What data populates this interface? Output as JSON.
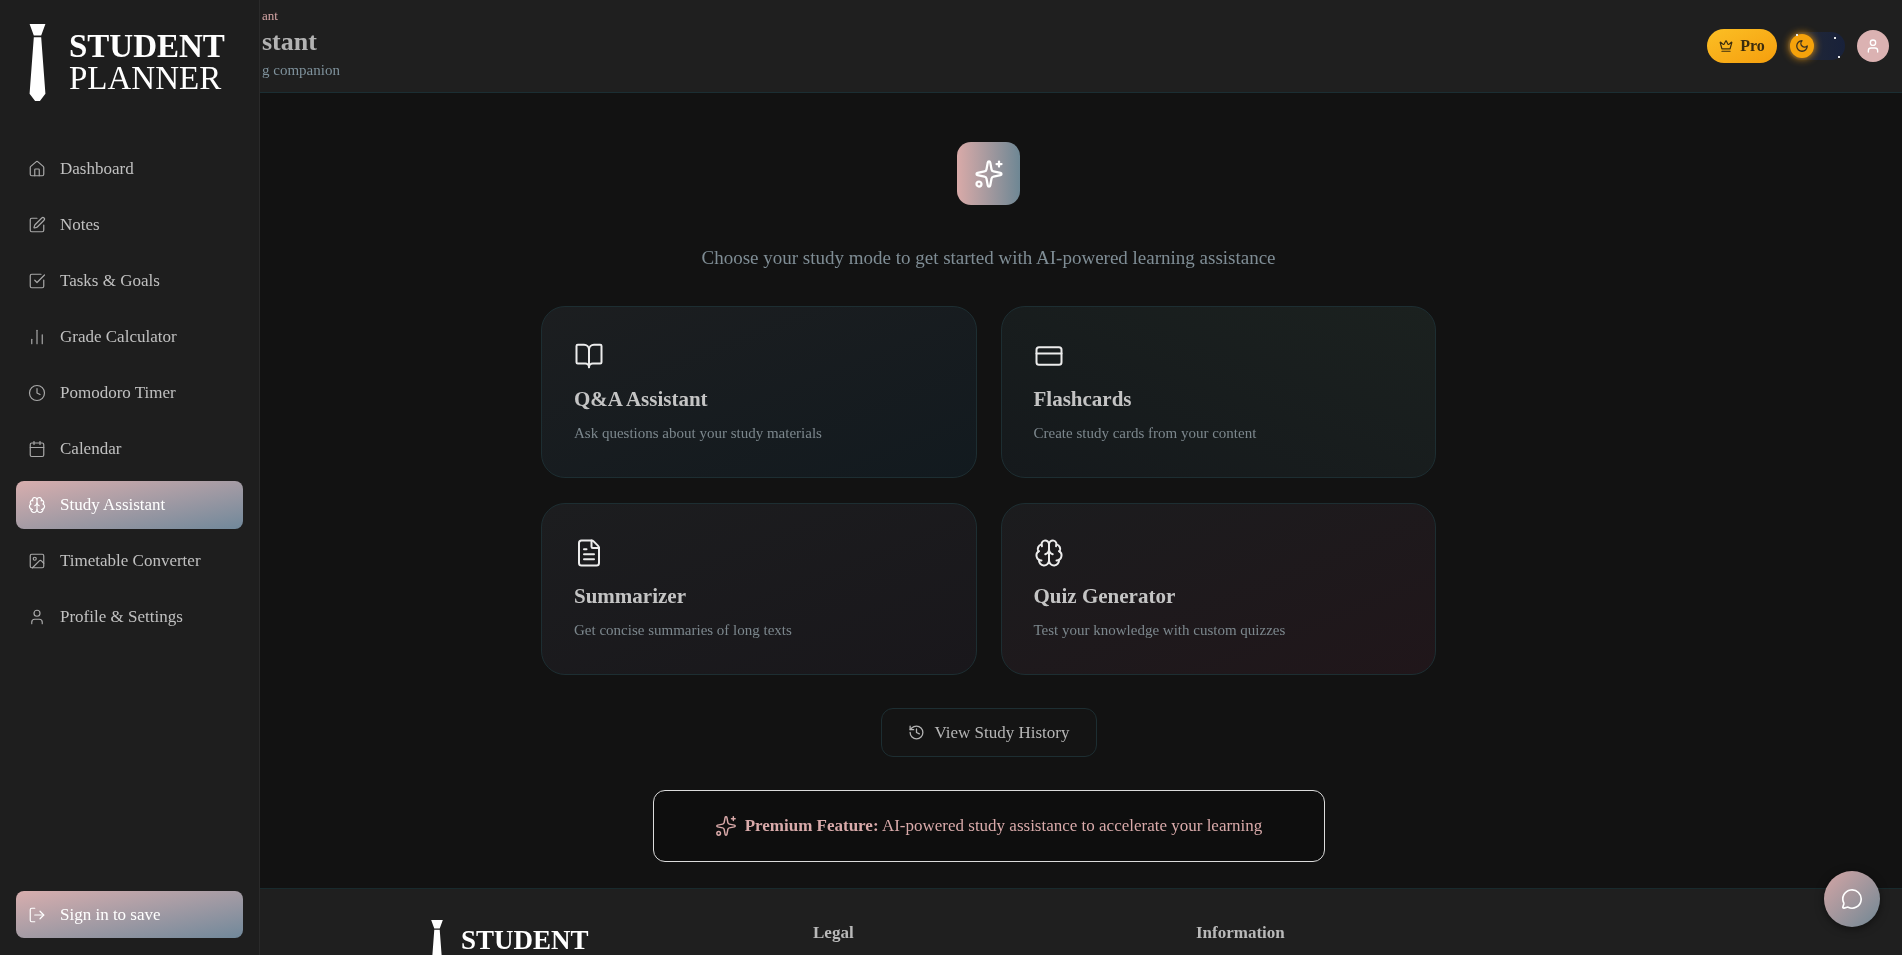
{
  "sidebar": {
    "logo": {
      "line_1": "STUDENT",
      "line_2": "PLANNER"
    },
    "items": [
      {
        "label": "Dashboard",
        "selected": false
      },
      {
        "label": "Notes",
        "selected": false
      },
      {
        "label": "Tasks & Goals",
        "selected": false
      },
      {
        "label": "Grade Calculator",
        "selected": false
      },
      {
        "label": "Pomodoro Timer",
        "selected": false
      },
      {
        "label": "Calendar",
        "selected": false
      },
      {
        "label": "Study Assistant",
        "selected": true
      },
      {
        "label": "Timetable Converter",
        "selected": false
      },
      {
        "label": "Profile & Settings",
        "selected": false
      }
    ],
    "sign_in_button": "Sign in to save"
  },
  "header": {
    "breadcrumb": "ant",
    "title": "stant",
    "subtitle": "g companion",
    "pro_button": "Pro",
    "theme_toggle": {
      "on": false
    }
  },
  "main": {
    "intro": "Choose your study mode to get started with AI-powered learning assistance",
    "modes": [
      {
        "title": "Q&A Assistant",
        "description": "Ask questions about your study materials"
      },
      {
        "title": "Flashcards",
        "description": "Create study cards from your content"
      },
      {
        "title": "Summarizer",
        "description": "Get concise summaries of long texts"
      },
      {
        "title": "Quiz Generator",
        "description": "Test your knowledge with custom quizzes"
      }
    ],
    "history_button": "View Study History",
    "premium_banner": "**Premium Feature:** AI-powered study assistance to accelerate your learning"
  },
  "footer": {
    "logo": "STUDENT",
    "columns": [
      "Legal",
      "Information"
    ]
  }
}
